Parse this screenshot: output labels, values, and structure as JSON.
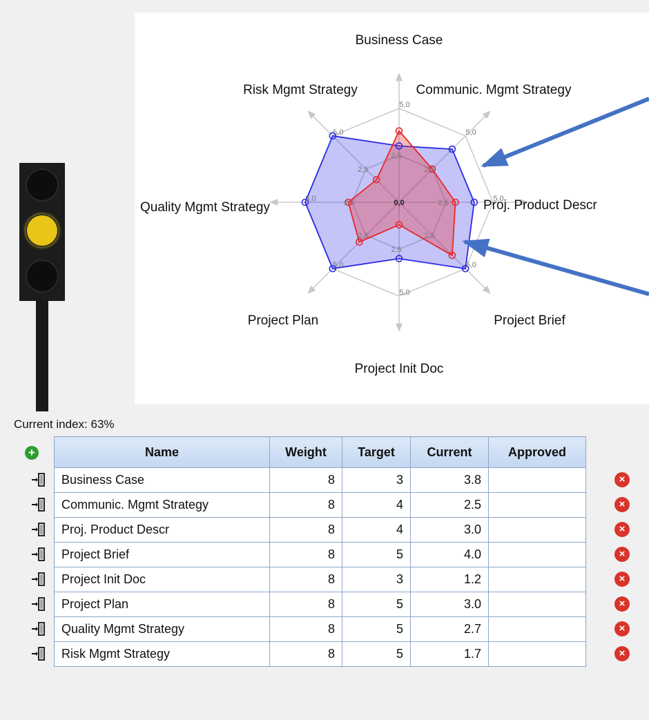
{
  "current_index_text": "Current index: 63%",
  "add_icon": "plus-circle-icon",
  "table": {
    "headers": [
      "Name",
      "Weight",
      "Target",
      "Current",
      "Approved"
    ],
    "rows": [
      {
        "name": "Business Case",
        "weight": "8",
        "target": "3",
        "current": "3.8",
        "approved": ""
      },
      {
        "name": "Communic. Mgmt Strategy",
        "weight": "8",
        "target": "4",
        "current": "2.5",
        "approved": ""
      },
      {
        "name": "Proj. Product Descr",
        "weight": "8",
        "target": "4",
        "current": "3.0",
        "approved": ""
      },
      {
        "name": "Project Brief",
        "weight": "8",
        "target": "5",
        "current": "4.0",
        "approved": ""
      },
      {
        "name": "Project Init Doc",
        "weight": "8",
        "target": "3",
        "current": "1.2",
        "approved": ""
      },
      {
        "name": "Project Plan",
        "weight": "8",
        "target": "5",
        "current": "3.0",
        "approved": ""
      },
      {
        "name": "Quality Mgmt Strategy",
        "weight": "8",
        "target": "5",
        "current": "2.7",
        "approved": ""
      },
      {
        "name": "Risk Mgmt Strategy",
        "weight": "8",
        "target": "5",
        "current": "1.7",
        "approved": ""
      }
    ],
    "row_icon": "enter-door-icon",
    "delete_icon": "delete-circle-icon"
  },
  "traffic_light": {
    "active": "yellow",
    "colors": {
      "lit": "#e8c516",
      "body": "#1c1c1c"
    }
  },
  "chart_data": {
    "type": "radar",
    "axes": [
      "Business Case",
      "Communic. Mgmt Strategy",
      "Proj. Product Descr",
      "Project Brief",
      "Project Init Doc",
      "Project Plan",
      "Quality Mgmt Strategy",
      "Risk Mgmt Strategy"
    ],
    "range": [
      0,
      5
    ],
    "tick_labels": [
      "0,0",
      "2,5",
      "5,0"
    ],
    "grid": true,
    "series": [
      {
        "values": [
          3,
          4,
          4,
          5,
          3,
          5,
          5,
          5
        ],
        "color": "#2a2ae8"
      },
      {
        "values": [
          3.8,
          2.5,
          3.0,
          4.0,
          1.2,
          3.0,
          2.7,
          1.7
        ],
        "color": "#e8282a"
      }
    ],
    "annotation_arrow_color": "#4472c4"
  }
}
